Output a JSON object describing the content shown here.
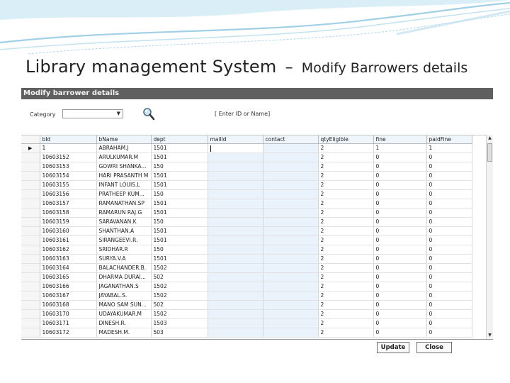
{
  "slide": {
    "title_main": "Library management System",
    "title_dash": "–",
    "title_sub": "Modify Barrowers details",
    "accent_color": "#8fc6de"
  },
  "window": {
    "title": "Modify barrower details"
  },
  "filters": {
    "category_label": "Category",
    "category_value": "",
    "search_icon": "magnifier-icon",
    "search_value": "",
    "search_hint": "[ Enter ID or Name]"
  },
  "grid": {
    "columns": [
      "bId",
      "bName",
      "dept",
      "mailId",
      "contact",
      "qtyEligible",
      "fine",
      "paidFine"
    ],
    "rows": [
      {
        "id": "1",
        "name": "ABRAHAM.J",
        "dept": "1501",
        "mail": "",
        "contact": "",
        "qty": "2",
        "fine": "1",
        "paid": "1"
      },
      {
        "id": "10603152",
        "name": "ARULKUMAR.M",
        "dept": "1501",
        "mail": "",
        "contact": "",
        "qty": "2",
        "fine": "0",
        "paid": "0"
      },
      {
        "id": "10603153",
        "name": "GOWRI SHANKA...",
        "dept": "150",
        "mail": "",
        "contact": "",
        "qty": "2",
        "fine": "0",
        "paid": "0"
      },
      {
        "id": "10603154",
        "name": "HARI PRASANTH M",
        "dept": "1501",
        "mail": "",
        "contact": "",
        "qty": "2",
        "fine": "0",
        "paid": "0"
      },
      {
        "id": "10603155",
        "name": "INFANT LOUIS.L",
        "dept": "1501",
        "mail": "",
        "contact": "",
        "qty": "2",
        "fine": "0",
        "paid": "0"
      },
      {
        "id": "10603156",
        "name": "PRATHEEP KUM...",
        "dept": "150",
        "mail": "",
        "contact": "",
        "qty": "2",
        "fine": "0",
        "paid": "0"
      },
      {
        "id": "10603157",
        "name": "RAMANATHAN.SP",
        "dept": "1501",
        "mail": "",
        "contact": "",
        "qty": "2",
        "fine": "0",
        "paid": "0"
      },
      {
        "id": "10603158",
        "name": "RAMARUN RAJ.G",
        "dept": "1501",
        "mail": "",
        "contact": "",
        "qty": "2",
        "fine": "0",
        "paid": "0"
      },
      {
        "id": "10603159",
        "name": "SARAVANAN.K",
        "dept": "150",
        "mail": "",
        "contact": "",
        "qty": "2",
        "fine": "0",
        "paid": "0"
      },
      {
        "id": "10603160",
        "name": "SHANTHAN.A",
        "dept": "1501",
        "mail": "",
        "contact": "",
        "qty": "2",
        "fine": "0",
        "paid": "0"
      },
      {
        "id": "10603161",
        "name": "SIRANGEEVI.R.",
        "dept": "1501",
        "mail": "",
        "contact": "",
        "qty": "2",
        "fine": "0",
        "paid": "0"
      },
      {
        "id": "10603162",
        "name": "SRIDHAR.R",
        "dept": "150",
        "mail": "",
        "contact": "",
        "qty": "2",
        "fine": "0",
        "paid": "0"
      },
      {
        "id": "10603163",
        "name": "SURYA.V.A",
        "dept": "1501",
        "mail": "",
        "contact": "",
        "qty": "2",
        "fine": "0",
        "paid": "0"
      },
      {
        "id": "10603164",
        "name": "BALACHANDER.B.",
        "dept": "1502",
        "mail": "",
        "contact": "",
        "qty": "2",
        "fine": "0",
        "paid": "0"
      },
      {
        "id": "10603165",
        "name": "DHARMA DURAI...",
        "dept": "502",
        "mail": "",
        "contact": "",
        "qty": "2",
        "fine": "0",
        "paid": "0"
      },
      {
        "id": "10603166",
        "name": "JAGANATHAN.S",
        "dept": "1502",
        "mail": "",
        "contact": "",
        "qty": "2",
        "fine": "0",
        "paid": "0"
      },
      {
        "id": "10603167",
        "name": "JAYABAL.S.",
        "dept": "1502",
        "mail": "",
        "contact": "",
        "qty": "2",
        "fine": "0",
        "paid": "0"
      },
      {
        "id": "10603168",
        "name": "MANO SAM SUN...",
        "dept": "502",
        "mail": "",
        "contact": "",
        "qty": "2",
        "fine": "0",
        "paid": "0"
      },
      {
        "id": "10603170",
        "name": "UDAYAKUMAR.M",
        "dept": "1502",
        "mail": "",
        "contact": "",
        "qty": "2",
        "fine": "0",
        "paid": "0"
      },
      {
        "id": "10603171",
        "name": "DINESH.R.",
        "dept": "1503",
        "mail": "",
        "contact": "",
        "qty": "2",
        "fine": "0",
        "paid": "0"
      },
      {
        "id": "10603172",
        "name": "MADESH.M.",
        "dept": "503",
        "mail": "",
        "contact": "",
        "qty": "2",
        "fine": "0",
        "paid": "0"
      }
    ]
  },
  "buttons": {
    "update": "Update",
    "close": "Close"
  }
}
